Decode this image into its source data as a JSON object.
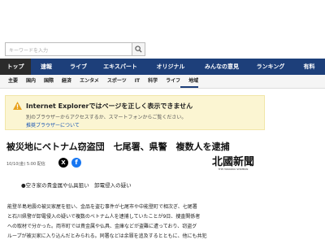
{
  "search": {
    "placeholder": "キーワードを入力"
  },
  "nav_main": [
    {
      "label": "トップ",
      "active": true
    },
    {
      "label": "速報",
      "active": false
    },
    {
      "label": "ライブ",
      "active": false
    },
    {
      "label": "エキスパート",
      "active": false
    },
    {
      "label": "オリジナル",
      "active": false
    },
    {
      "label": "みんなの意見",
      "active": false
    },
    {
      "label": "ランキング",
      "active": false
    },
    {
      "label": "有料",
      "active": false
    }
  ],
  "nav_sub": [
    {
      "label": "主要",
      "active": false
    },
    {
      "label": "国内",
      "active": false
    },
    {
      "label": "国際",
      "active": false
    },
    {
      "label": "経済",
      "active": false
    },
    {
      "label": "エンタメ",
      "active": false
    },
    {
      "label": "スポーツ",
      "active": false
    },
    {
      "label": "IT",
      "active": false
    },
    {
      "label": "科学",
      "active": false
    },
    {
      "label": "ライフ",
      "active": false
    },
    {
      "label": "地域",
      "active": true
    }
  ],
  "ie_warning": {
    "title": "Internet Explorerではページを正しく表示できません",
    "text": "別のブラウザーからアクセスするか、スマートフォンからご覧ください。",
    "link": "推奨ブラウザーについて"
  },
  "article": {
    "headline": "被災地にベトナム窃盗団　七尾署、県警　複数人を逮捕",
    "date": "10/10(金) 5:00 配信",
    "source_logo": "北國新聞",
    "source_logo_sub": "THE HOKKOKU SHIMBUN",
    "subhead": "●空き家の貴金属や仏具狙い　卸電侵入の疑い",
    "body_lines": [
      "能登半島地震の被災家屋を狙い、金品を盗む事件が七尾市や中能登町で相次ぎ、七尾署",
      "と石川県警が卸電侵入の疑いで複数のベトナム人を逮捕していたことが9日、捜査関係者",
      "への取材で分かった。両市町では貴金属や仏具、金庫などが盗難に遭っており、窃盗グ",
      "ループが被災家に入り込んだとみられる。同署などは余罪を追及するとともに、他にも共犯"
    ]
  },
  "colors": {
    "nav_bg": "#1d3f7a",
    "nav_active": "#2b2b2b",
    "warning_bg": "#fbf5d2",
    "link": "#1a56b4"
  }
}
